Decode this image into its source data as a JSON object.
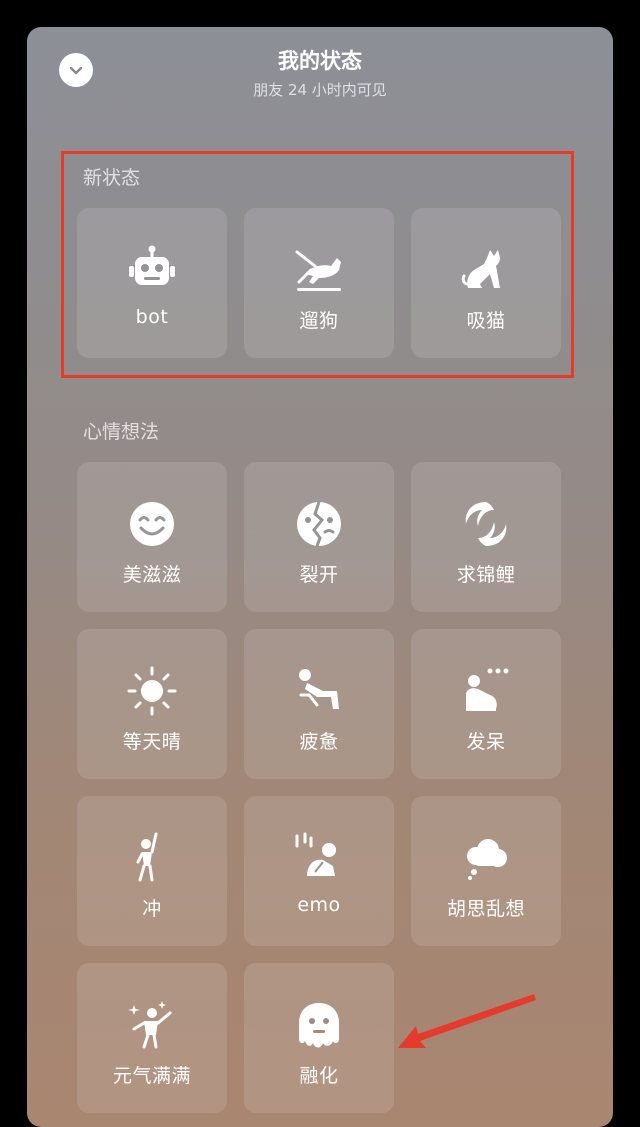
{
  "header": {
    "title": "我的状态",
    "subtitle": "朋友 24 小时内可见",
    "collapse_icon": "chevron-down-icon"
  },
  "sections": [
    {
      "label": "新状态",
      "items": [
        {
          "label": "bot",
          "icon": "robot-icon"
        },
        {
          "label": "遛狗",
          "icon": "walk-dog-icon"
        },
        {
          "label": "吸猫",
          "icon": "cat-stretch-icon"
        }
      ]
    },
    {
      "label": "心情想法",
      "items": [
        {
          "label": "美滋滋",
          "icon": "smile-icon"
        },
        {
          "label": "裂开",
          "icon": "cracked-face-icon"
        },
        {
          "label": "求锦鲤",
          "icon": "koi-icon"
        },
        {
          "label": "等天晴",
          "icon": "sun-icon"
        },
        {
          "label": "疲惫",
          "icon": "tired-person-icon"
        },
        {
          "label": "发呆",
          "icon": "daze-person-icon"
        },
        {
          "label": "冲",
          "icon": "cheer-person-icon"
        },
        {
          "label": "emo",
          "icon": "emo-person-icon"
        },
        {
          "label": "胡思乱想",
          "icon": "thought-cloud-icon"
        },
        {
          "label": "元气满满",
          "icon": "energetic-person-icon"
        },
        {
          "label": "融化",
          "icon": "melting-face-icon"
        }
      ]
    }
  ],
  "annotation_colors": {
    "highlight": "#e53b2c",
    "arrow": "#e53b2c"
  }
}
